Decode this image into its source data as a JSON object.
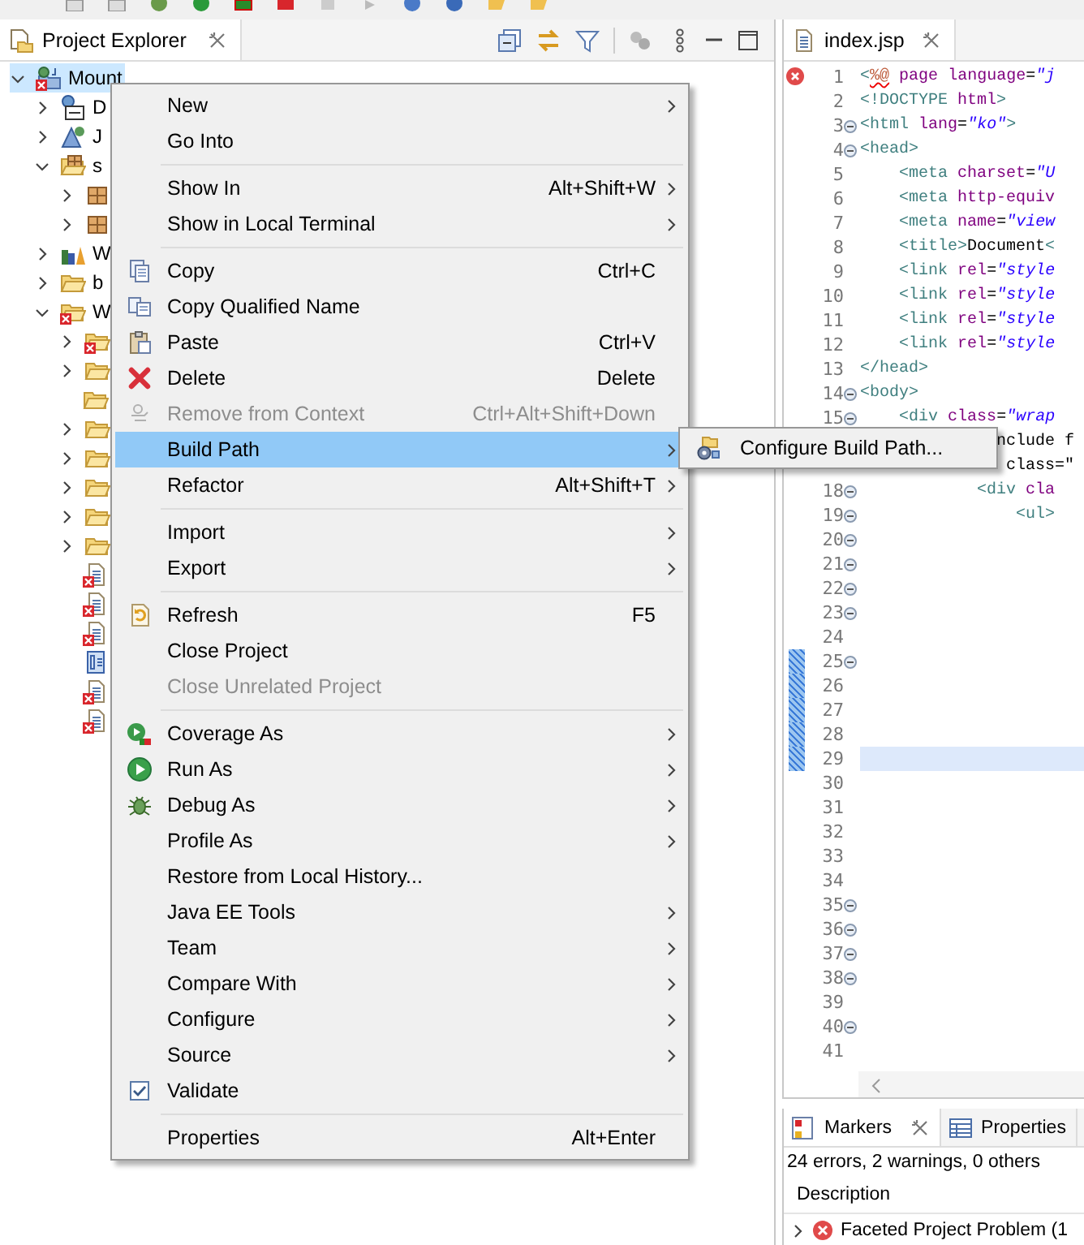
{
  "explorer": {
    "title": "Project Explorer",
    "tree": [
      {
        "kind": "project",
        "label": "Mount",
        "error": true,
        "expanded": true,
        "selected": true,
        "children": [
          {
            "kind": "descriptor",
            "label": "D",
            "error": false,
            "expanded": false,
            "selected": false
          },
          {
            "kind": "webservice",
            "label": "J",
            "error": false,
            "expanded": false,
            "selected": false
          },
          {
            "kind": "source",
            "label": "s",
            "error": false,
            "expanded": true,
            "selected": false,
            "children": [
              {
                "kind": "package",
                "error": false,
                "expanded": false,
                "selected": false
              },
              {
                "kind": "package",
                "error": false,
                "expanded": false,
                "selected": false
              }
            ]
          },
          {
            "kind": "library",
            "label": "W",
            "error": false,
            "expanded": false,
            "selected": false
          },
          {
            "kind": "folder",
            "label": "b",
            "error": false,
            "expanded": false,
            "selected": false
          },
          {
            "kind": "folder",
            "label": "W",
            "error": true,
            "expanded": true,
            "selected": false,
            "children": [
              {
                "kind": "folder",
                "error": true,
                "expanded": false,
                "selected": false
              },
              {
                "kind": "folder",
                "error": false,
                "expanded": false,
                "selected": false
              },
              {
                "kind": "folder",
                "error": false,
                "selected": false
              },
              {
                "kind": "folder",
                "error": false,
                "expanded": false,
                "selected": false
              },
              {
                "kind": "folder",
                "error": false,
                "expanded": false,
                "selected": false
              },
              {
                "kind": "folder",
                "error": false,
                "expanded": false,
                "selected": false
              },
              {
                "kind": "folder",
                "error": false,
                "expanded": false,
                "selected": false
              },
              {
                "kind": "folder",
                "error": false,
                "expanded": false,
                "selected": false
              },
              {
                "kind": "file",
                "error": true,
                "selected": false
              },
              {
                "kind": "file",
                "error": true,
                "selected": false
              },
              {
                "kind": "file",
                "error": true,
                "selected": false
              },
              {
                "kind": "xmlfile",
                "error": false,
                "selected": false
              },
              {
                "kind": "file",
                "error": true,
                "selected": false
              },
              {
                "kind": "file",
                "error": true,
                "selected": false
              }
            ]
          }
        ]
      }
    ]
  },
  "context_menu": {
    "items": [
      {
        "kind": "item",
        "label": "New",
        "submenu": true,
        "disabled": false,
        "selected": false
      },
      {
        "kind": "item",
        "label": "Go Into",
        "submenu": false,
        "disabled": false,
        "selected": false
      },
      {
        "kind": "separator"
      },
      {
        "kind": "item",
        "label": "Show In",
        "shortcut": "Alt+Shift+W",
        "submenu": true,
        "disabled": false,
        "selected": false
      },
      {
        "kind": "item",
        "label": "Show in Local Terminal",
        "submenu": true,
        "disabled": false,
        "selected": false
      },
      {
        "kind": "separator"
      },
      {
        "kind": "item",
        "label": "Copy",
        "shortcut": "Ctrl+C",
        "submenu": false,
        "disabled": false,
        "selected": false
      },
      {
        "kind": "item",
        "label": "Copy Qualified Name",
        "submenu": false,
        "disabled": false,
        "selected": false
      },
      {
        "kind": "item",
        "label": "Paste",
        "shortcut": "Ctrl+V",
        "submenu": false,
        "disabled": false,
        "selected": false
      },
      {
        "kind": "item",
        "label": "Delete",
        "shortcut": "Delete",
        "submenu": false,
        "disabled": false,
        "selected": false
      },
      {
        "kind": "item",
        "label": "Remove from Context",
        "shortcut": "Ctrl+Alt+Shift+Down",
        "submenu": false,
        "disabled": true,
        "selected": false
      },
      {
        "kind": "item",
        "label": "Build Path",
        "submenu": true,
        "disabled": false,
        "selected": true
      },
      {
        "kind": "item",
        "label": "Refactor",
        "shortcut": "Alt+Shift+T",
        "submenu": true,
        "disabled": false,
        "selected": false
      },
      {
        "kind": "separator"
      },
      {
        "kind": "item",
        "label": "Import",
        "submenu": true,
        "disabled": false,
        "selected": false
      },
      {
        "kind": "item",
        "label": "Export",
        "submenu": true,
        "disabled": false,
        "selected": false
      },
      {
        "kind": "separator"
      },
      {
        "kind": "item",
        "label": "Refresh",
        "shortcut": "F5",
        "submenu": false,
        "disabled": false,
        "selected": false
      },
      {
        "kind": "item",
        "label": "Close Project",
        "submenu": false,
        "disabled": false,
        "selected": false
      },
      {
        "kind": "item",
        "label": "Close Unrelated Project",
        "submenu": false,
        "disabled": true,
        "selected": false
      },
      {
        "kind": "separator"
      },
      {
        "kind": "item",
        "label": "Coverage As",
        "submenu": true,
        "disabled": false,
        "selected": false
      },
      {
        "kind": "item",
        "label": "Run As",
        "submenu": true,
        "disabled": false,
        "selected": false
      },
      {
        "kind": "item",
        "label": "Debug As",
        "submenu": true,
        "disabled": false,
        "selected": false
      },
      {
        "kind": "item",
        "label": "Profile As",
        "submenu": true,
        "disabled": false,
        "selected": false
      },
      {
        "kind": "item",
        "label": "Restore from Local History...",
        "submenu": false,
        "disabled": false,
        "selected": false
      },
      {
        "kind": "item",
        "label": "Java EE Tools",
        "submenu": true,
        "disabled": false,
        "selected": false
      },
      {
        "kind": "item",
        "label": "Team",
        "submenu": true,
        "disabled": false,
        "selected": false
      },
      {
        "kind": "item",
        "label": "Compare With",
        "submenu": true,
        "disabled": false,
        "selected": false
      },
      {
        "kind": "item",
        "label": "Configure",
        "submenu": true,
        "disabled": false,
        "selected": false
      },
      {
        "kind": "item",
        "label": "Source",
        "submenu": true,
        "disabled": false,
        "selected": false
      },
      {
        "kind": "check",
        "label": "Validate",
        "checked": true,
        "submenu": false,
        "disabled": false,
        "selected": false
      },
      {
        "kind": "separator"
      },
      {
        "kind": "item",
        "label": "Properties",
        "shortcut": "Alt+Enter",
        "submenu": false,
        "disabled": false,
        "selected": false
      }
    ]
  },
  "submenu": {
    "items": [
      {
        "kind": "item",
        "label": "Configure Build Path...",
        "submenu": false,
        "disabled": false,
        "selected": false
      }
    ]
  },
  "editor": {
    "tab": {
      "label": "index.jsp",
      "selected": true
    },
    "lines": [
      {
        "number": "1",
        "text": "<%@ page language=\"j",
        "fold": false,
        "error": true,
        "changed": false,
        "current": false
      },
      {
        "number": "2",
        "text": "<!DOCTYPE html>",
        "fold": false,
        "error": false,
        "changed": false,
        "current": false
      },
      {
        "number": "3",
        "text": "<html lang=\"ko\">",
        "fold": true,
        "error": false,
        "changed": false,
        "current": false
      },
      {
        "number": "4",
        "text": "<head>",
        "fold": true,
        "error": false,
        "changed": false,
        "current": false
      },
      {
        "number": "5",
        "text": "    <meta charset=\"U",
        "fold": false,
        "error": false,
        "changed": false,
        "current": false
      },
      {
        "number": "6",
        "text": "    <meta http-equiv",
        "fold": false,
        "error": false,
        "changed": false,
        "current": false
      },
      {
        "number": "7",
        "text": "    <meta name=\"view",
        "fold": false,
        "error": false,
        "changed": false,
        "current": false
      },
      {
        "number": "8",
        "text": "    <title>Document<",
        "fold": false,
        "error": false,
        "changed": false,
        "current": false
      },
      {
        "number": "9",
        "text": "    <link rel=\"style",
        "fold": false,
        "error": false,
        "changed": false,
        "current": false
      },
      {
        "number": "10",
        "text": "    <link rel=\"style",
        "fold": false,
        "error": false,
        "changed": false,
        "current": false
      },
      {
        "number": "11",
        "text": "    <link rel=\"style",
        "fold": false,
        "error": false,
        "changed": false,
        "current": false
      },
      {
        "number": "12",
        "text": "    <link rel=\"style",
        "fold": false,
        "error": false,
        "changed": false,
        "current": false
      },
      {
        "number": "13",
        "text": "</head>",
        "fold": false,
        "error": false,
        "changed": false,
        "current": false
      },
      {
        "number": "14",
        "text": "<body>",
        "fold": true,
        "error": false,
        "changed": false,
        "current": false
      },
      {
        "number": "15",
        "text": "    <div class=\"wrap",
        "fold": true,
        "error": false,
        "changed": false,
        "current": false
      },
      {
        "text": "              nclude f"
      },
      {
        "text": "               class=\""
      },
      {
        "number": "18",
        "text": "            <div cla",
        "fold": true,
        "error": false,
        "changed": false,
        "current": false
      },
      {
        "number": "19",
        "text": "                <ul>",
        "fold": true,
        "error": false,
        "changed": false,
        "current": false
      },
      {
        "number": "20",
        "fold": true,
        "error": false,
        "changed": false,
        "current": false
      },
      {
        "number": "21",
        "fold": true,
        "error": false,
        "changed": false,
        "current": false
      },
      {
        "number": "22",
        "fold": true,
        "error": false,
        "changed": false,
        "current": false
      },
      {
        "number": "23",
        "fold": true,
        "error": false,
        "changed": false,
        "current": false
      },
      {
        "number": "24",
        "fold": false,
        "error": false,
        "changed": false,
        "current": false
      },
      {
        "number": "25",
        "fold": true,
        "error": false,
        "changed": true,
        "current": false
      },
      {
        "number": "26",
        "fold": false,
        "error": false,
        "changed": true,
        "current": false
      },
      {
        "number": "27",
        "fold": false,
        "error": false,
        "changed": true,
        "current": false
      },
      {
        "number": "28",
        "fold": false,
        "error": false,
        "changed": true,
        "current": false
      },
      {
        "number": "29",
        "fold": false,
        "error": false,
        "changed": true,
        "current": true
      },
      {
        "number": "30",
        "fold": false,
        "error": false,
        "changed": false,
        "current": false
      },
      {
        "number": "31",
        "fold": false,
        "error": false,
        "changed": false,
        "current": false
      },
      {
        "number": "32",
        "fold": false,
        "error": false,
        "changed": false,
        "current": false
      },
      {
        "number": "33",
        "fold": false,
        "error": false,
        "changed": false,
        "current": false
      },
      {
        "number": "34",
        "fold": false,
        "error": false,
        "changed": false,
        "current": false
      },
      {
        "number": "35",
        "fold": true,
        "error": false,
        "changed": false,
        "current": false
      },
      {
        "number": "36",
        "fold": true,
        "error": false,
        "changed": false,
        "current": false
      },
      {
        "number": "37",
        "fold": true,
        "error": false,
        "changed": false,
        "current": false
      },
      {
        "number": "38",
        "fold": true,
        "error": false,
        "changed": false,
        "current": false
      },
      {
        "number": "39",
        "fold": false,
        "error": false,
        "changed": false,
        "current": false
      },
      {
        "number": "40",
        "fold": true,
        "error": false,
        "changed": false,
        "current": false
      },
      {
        "number": "41",
        "fold": false,
        "error": false,
        "changed": false,
        "current": false
      }
    ]
  },
  "markers": {
    "tabs": [
      {
        "label": "Markers",
        "kind": "markers",
        "selected": true
      },
      {
        "label": "Properties",
        "kind": "properties",
        "selected": false
      }
    ],
    "summary": "24 errors, 2 warnings, 0 others",
    "columns": [
      "Description"
    ],
    "rows": [
      {
        "description": "Faceted Project Problem (1",
        "expanded": false
      }
    ]
  }
}
